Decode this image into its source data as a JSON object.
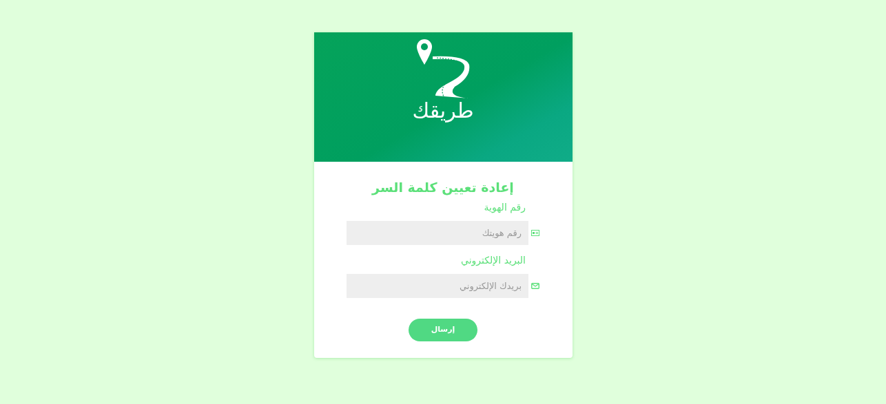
{
  "brand": {
    "name": "طريقك"
  },
  "form": {
    "title": "إعادة تعيين كلمة السر",
    "fields": [
      {
        "kind": "id",
        "label": "رقم الهوية",
        "placeholder": "رقم هويتك"
      },
      {
        "kind": "email",
        "label": "البريد الإلكتروني",
        "placeholder": "بريدك الإلكتروني"
      }
    ],
    "submit": "إرسال"
  }
}
